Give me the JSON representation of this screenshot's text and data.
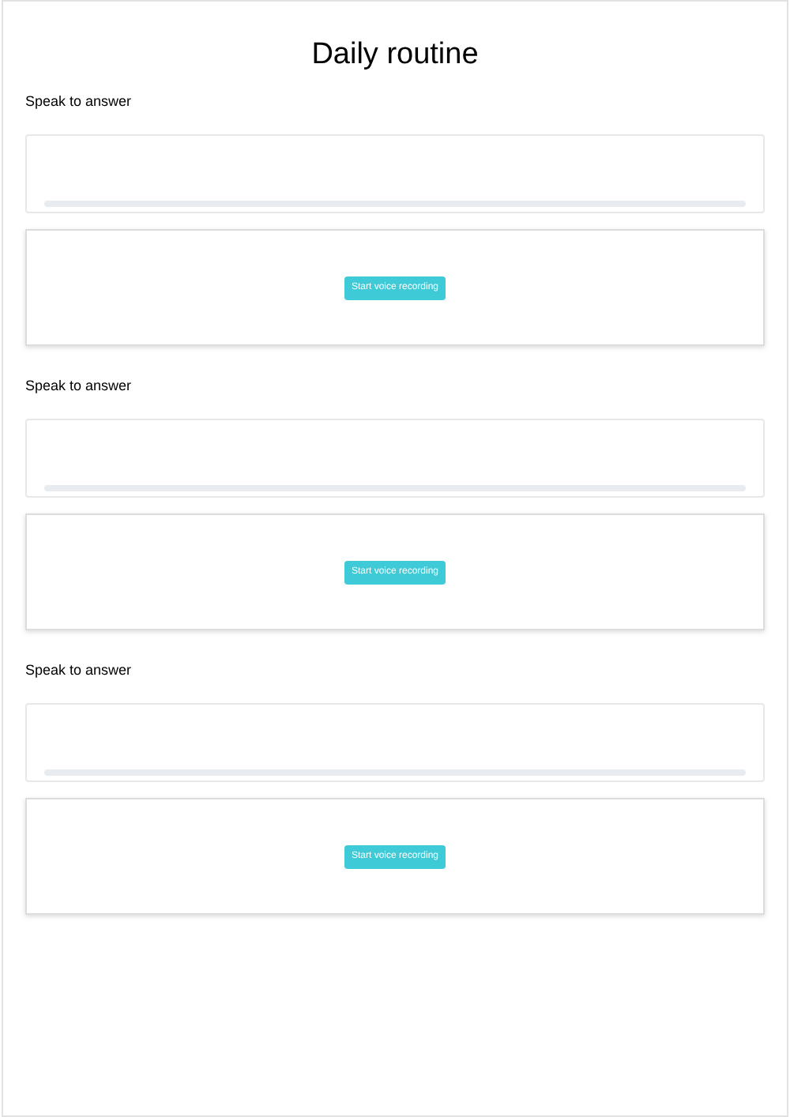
{
  "title": "Daily routine",
  "questions": [
    {
      "prompt": "Speak to answer",
      "button": "Start voice recording"
    },
    {
      "prompt": "Speak to answer",
      "button": "Start voice recording"
    },
    {
      "prompt": "Speak to answer",
      "button": "Start voice recording"
    }
  ]
}
